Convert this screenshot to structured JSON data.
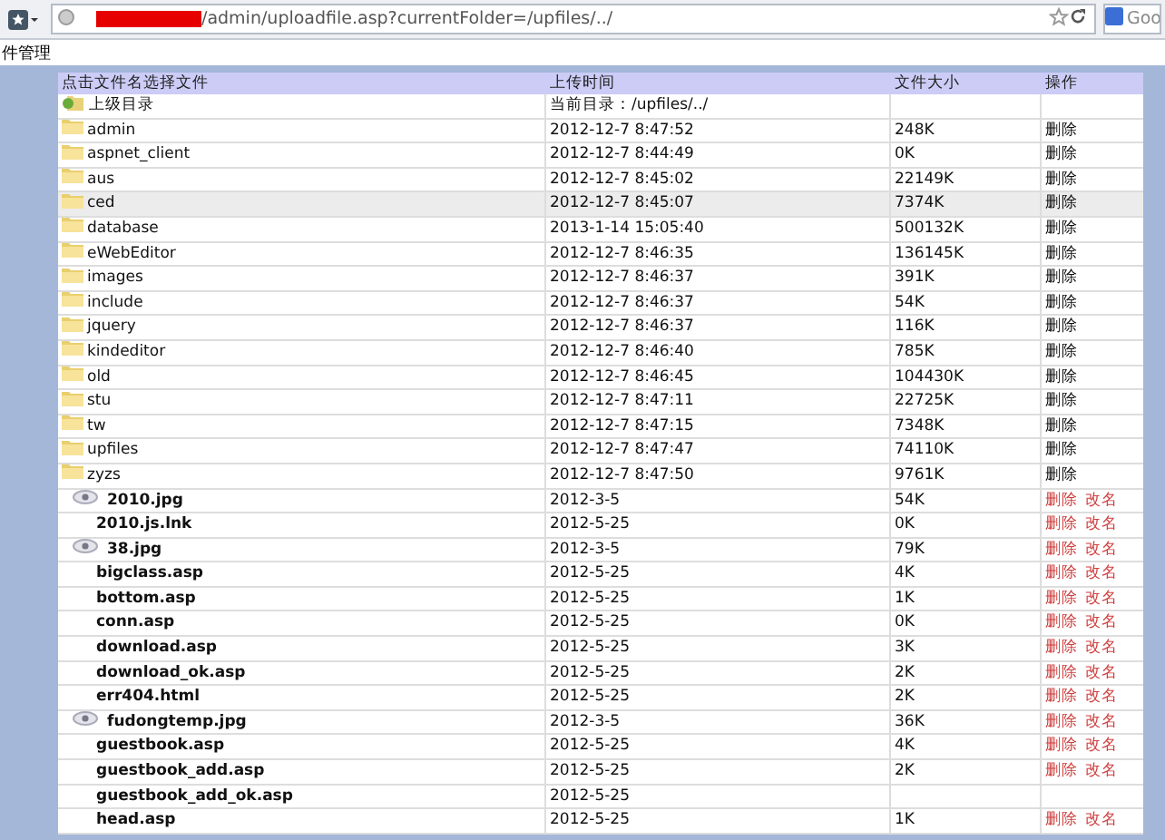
{
  "browser": {
    "address": "/admin/uploadfile.asp?currentFolder=/upfiles/../",
    "search_text": "Goo"
  },
  "page_title": "件管理",
  "table": {
    "columns": [
      "点击文件名选择文件",
      "上传时间",
      "文件大小",
      "操作"
    ],
    "parent_row": {
      "name": "上级目录",
      "current_folder": "当前目录：/upfiles/../"
    },
    "rows": [
      {
        "kind": "folder",
        "name": "admin",
        "time": "2012-12-7 8:47:52",
        "size": "248K",
        "actions": [
          "删除"
        ],
        "selected": false
      },
      {
        "kind": "folder",
        "name": "aspnet_client",
        "time": "2012-12-7 8:44:49",
        "size": "0K",
        "actions": [
          "删除"
        ],
        "selected": false
      },
      {
        "kind": "folder",
        "name": "aus",
        "time": "2012-12-7 8:45:02",
        "size": "22149K",
        "actions": [
          "删除"
        ],
        "selected": false
      },
      {
        "kind": "folder",
        "name": "ced",
        "time": "2012-12-7 8:45:07",
        "size": "7374K",
        "actions": [
          "删除"
        ],
        "selected": true
      },
      {
        "kind": "folder",
        "name": "database",
        "time": "2013-1-14 15:05:40",
        "size": "500132K",
        "actions": [
          "删除"
        ],
        "selected": false
      },
      {
        "kind": "folder",
        "name": "eWebEditor",
        "time": "2012-12-7 8:46:35",
        "size": "136145K",
        "actions": [
          "删除"
        ],
        "selected": false
      },
      {
        "kind": "folder",
        "name": "images",
        "time": "2012-12-7 8:46:37",
        "size": "391K",
        "actions": [
          "删除"
        ],
        "selected": false
      },
      {
        "kind": "folder",
        "name": "include",
        "time": "2012-12-7 8:46:37",
        "size": "54K",
        "actions": [
          "删除"
        ],
        "selected": false
      },
      {
        "kind": "folder",
        "name": "jquery",
        "time": "2012-12-7 8:46:37",
        "size": "116K",
        "actions": [
          "删除"
        ],
        "selected": false
      },
      {
        "kind": "folder",
        "name": "kindeditor",
        "time": "2012-12-7 8:46:40",
        "size": "785K",
        "actions": [
          "删除"
        ],
        "selected": false
      },
      {
        "kind": "folder",
        "name": "old",
        "time": "2012-12-7 8:46:45",
        "size": "104430K",
        "actions": [
          "删除"
        ],
        "selected": false
      },
      {
        "kind": "folder",
        "name": "stu",
        "time": "2012-12-7 8:47:11",
        "size": "22725K",
        "actions": [
          "删除"
        ],
        "selected": false
      },
      {
        "kind": "folder",
        "name": "tw",
        "time": "2012-12-7 8:47:15",
        "size": "7348K",
        "actions": [
          "删除"
        ],
        "selected": false
      },
      {
        "kind": "folder",
        "name": "upfiles",
        "time": "2012-12-7 8:47:47",
        "size": "74110K",
        "actions": [
          "删除"
        ],
        "selected": false
      },
      {
        "kind": "folder",
        "name": "zyzs",
        "time": "2012-12-7 8:47:50",
        "size": "9761K",
        "actions": [
          "删除"
        ],
        "selected": false
      },
      {
        "kind": "image",
        "name": "2010.jpg",
        "time": "2012-3-5",
        "size": "54K",
        "actions": [
          "删除",
          "改名"
        ],
        "selected": false
      },
      {
        "kind": "file",
        "name": "2010.js.lnk",
        "time": "2012-5-25",
        "size": "0K",
        "actions": [
          "删除",
          "改名"
        ],
        "selected": false
      },
      {
        "kind": "image",
        "name": "38.jpg",
        "time": "2012-3-5",
        "size": "79K",
        "actions": [
          "删除",
          "改名"
        ],
        "selected": false
      },
      {
        "kind": "file",
        "name": "bigclass.asp",
        "time": "2012-5-25",
        "size": "4K",
        "actions": [
          "删除",
          "改名"
        ],
        "selected": false
      },
      {
        "kind": "file",
        "name": "bottom.asp",
        "time": "2012-5-25",
        "size": "1K",
        "actions": [
          "删除",
          "改名"
        ],
        "selected": false
      },
      {
        "kind": "file",
        "name": "conn.asp",
        "time": "2012-5-25",
        "size": "0K",
        "actions": [
          "删除",
          "改名"
        ],
        "selected": false
      },
      {
        "kind": "file",
        "name": "download.asp",
        "time": "2012-5-25",
        "size": "3K",
        "actions": [
          "删除",
          "改名"
        ],
        "selected": false
      },
      {
        "kind": "file",
        "name": "download_ok.asp",
        "time": "2012-5-25",
        "size": "2K",
        "actions": [
          "删除",
          "改名"
        ],
        "selected": false
      },
      {
        "kind": "file",
        "name": "err404.html",
        "time": "2012-5-25",
        "size": "2K",
        "actions": [
          "删除",
          "改名"
        ],
        "selected": false
      },
      {
        "kind": "image",
        "name": "fudongtemp.jpg",
        "time": "2012-3-5",
        "size": "36K",
        "actions": [
          "删除",
          "改名"
        ],
        "selected": false
      },
      {
        "kind": "file",
        "name": "guestbook.asp",
        "time": "2012-5-25",
        "size": "4K",
        "actions": [
          "删除",
          "改名"
        ],
        "selected": false
      },
      {
        "kind": "file",
        "name": "guestbook_add.asp",
        "time": "2012-5-25",
        "size": "2K",
        "actions": [
          "删除",
          "改名"
        ],
        "selected": false
      },
      {
        "kind": "file",
        "name": "guestbook_add_ok.asp",
        "time": "2012-5-25",
        "actions": [],
        "selected": false
      },
      {
        "kind": "file",
        "name": "head.asp",
        "time": "2012-5-25",
        "size": "1K",
        "actions": [
          "删除",
          "改名"
        ],
        "selected": false
      }
    ]
  }
}
